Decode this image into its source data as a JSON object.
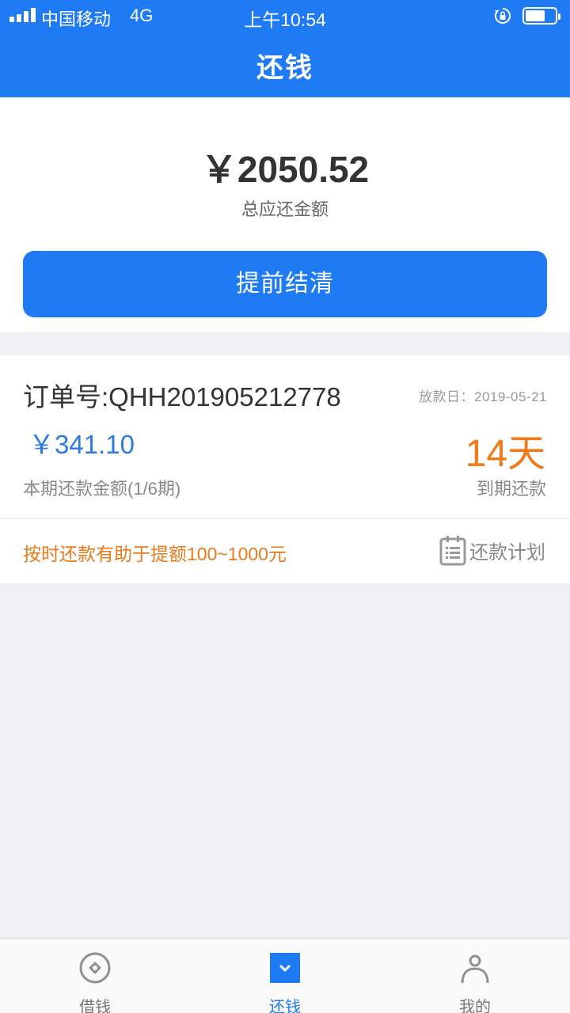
{
  "status_bar": {
    "carrier": "中国移动",
    "network": "4G",
    "time": "上午10:54"
  },
  "nav": {
    "title": "还钱"
  },
  "summary": {
    "total_amount": "￥2050.52",
    "total_label": "总应还金额",
    "settle_button": "提前结清"
  },
  "order": {
    "order_no": "订单号:QHH201905212778",
    "loan_date": "放款日：2019-05-21",
    "period_amount": "￥341.10",
    "days_left": "14天",
    "period_label": "本期还款金额(1/6期)",
    "due_label": "到期还款",
    "promo": "按时还款有助于提额100~1000元",
    "plan_link": "还款计划"
  },
  "tabbar": {
    "active": "还钱",
    "tabs": [
      {
        "label": "借钱",
        "icon": "coin-circle-icon"
      },
      {
        "label": "还钱",
        "icon": "repay-icon"
      },
      {
        "label": "我的",
        "icon": "person-icon"
      }
    ]
  },
  "colors": {
    "brand_blue": "#1f7bf4",
    "accent_orange": "#f07a17",
    "amount_blue": "#2a7ae2",
    "page_background": "#efeff4"
  }
}
